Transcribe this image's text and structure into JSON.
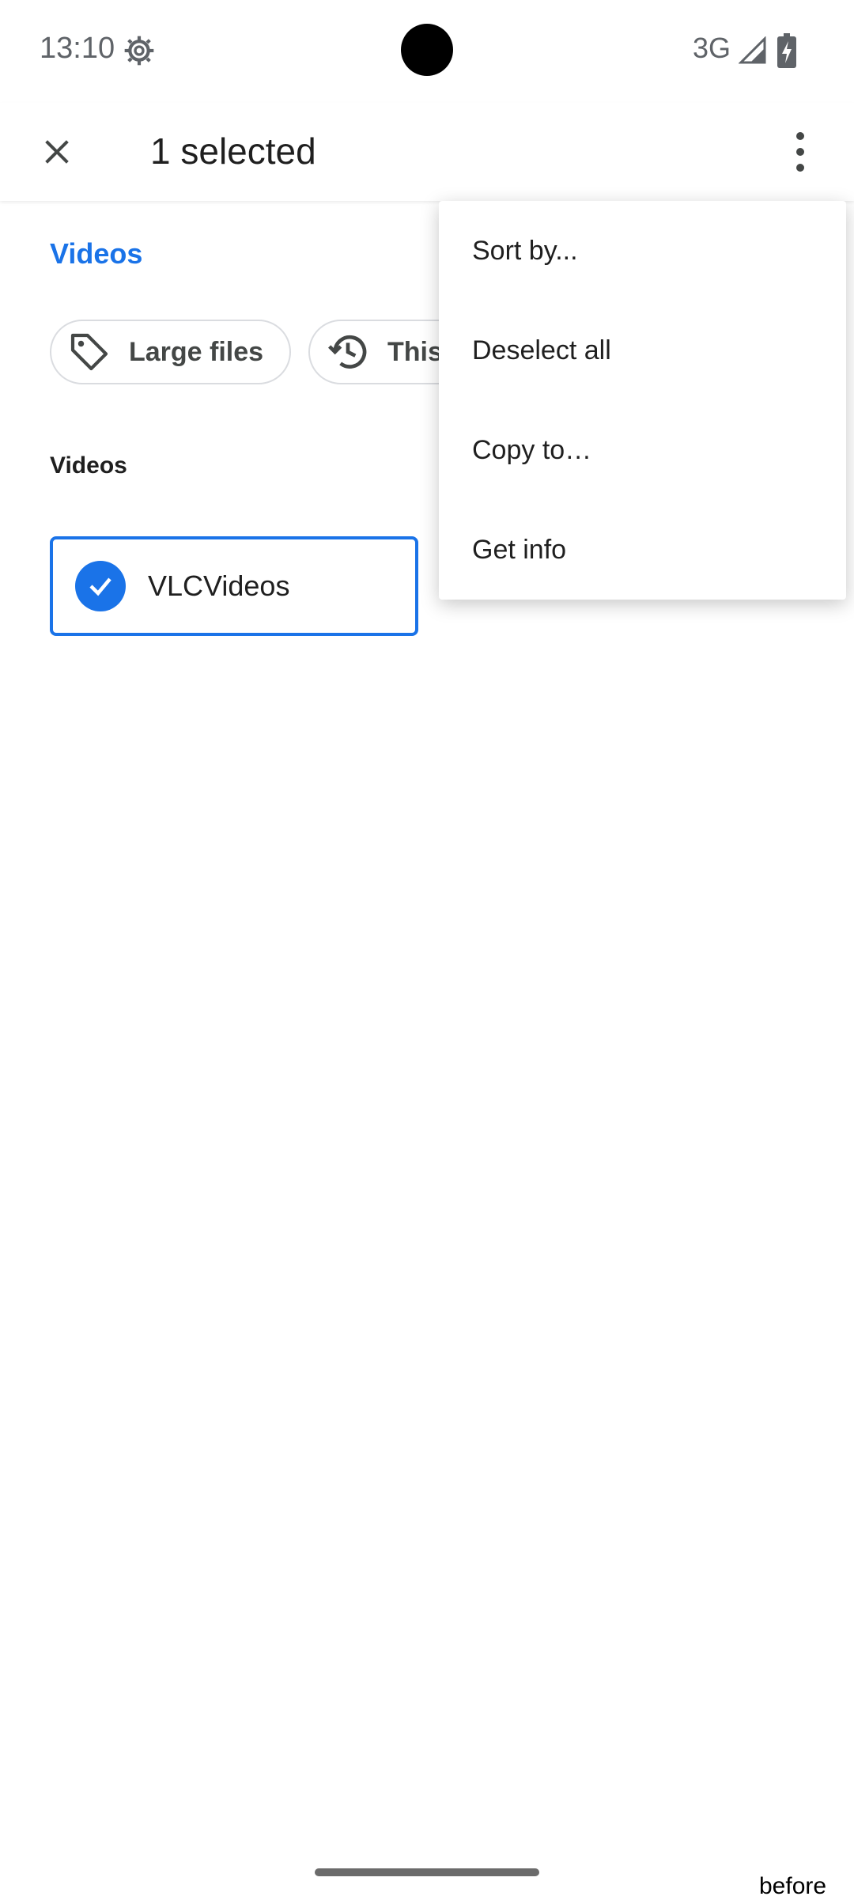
{
  "status_bar": {
    "time": "13:10",
    "network": "3G",
    "icons": [
      "settings-gear-icon",
      "signal-icon",
      "battery-charging-icon"
    ]
  },
  "app_bar": {
    "title": "1 selected",
    "close_icon": "close-icon",
    "more_icon": "more-vert-icon"
  },
  "content": {
    "section_link": "Videos",
    "chips": [
      {
        "label": "Large files",
        "icon": "tag-icon"
      },
      {
        "label": "This",
        "icon": "history-icon"
      }
    ],
    "subheading": "Videos",
    "folders": [
      {
        "name": "VLCVideos",
        "selected": true
      }
    ]
  },
  "menu": {
    "items": [
      {
        "label": "Sort by..."
      },
      {
        "label": "Deselect all"
      },
      {
        "label": "Copy to…"
      },
      {
        "label": "Get info"
      }
    ]
  },
  "caption": "before",
  "colors": {
    "accent": "#1a73e8",
    "text": "#1f1f1f",
    "muted": "#5f6368"
  }
}
